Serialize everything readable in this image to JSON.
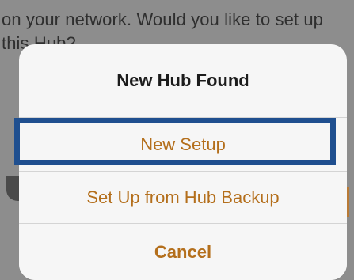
{
  "background": {
    "message_line1": "on your network. Would you like to set up",
    "message_line2": "this Hub?"
  },
  "dialog": {
    "title": "New Hub Found",
    "options": [
      {
        "label": "New Setup"
      },
      {
        "label": "Set Up from Hub Backup"
      },
      {
        "label": "Cancel"
      }
    ]
  },
  "colors": {
    "accent": "#b46f1c",
    "highlight_border": "#1f4f8f",
    "sheet_bg": "#f6f6f6"
  }
}
